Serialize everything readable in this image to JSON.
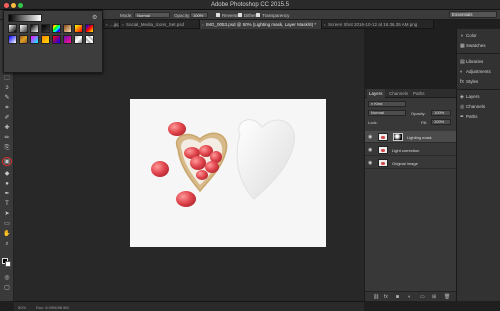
{
  "window": {
    "title": "Adobe Photoshop CC 2015.5"
  },
  "options_bar": {
    "mode_label": "Mode:",
    "mode_value": "Normal",
    "opacity_label": "Opacity:",
    "opacity_value": "100%",
    "reverse_label": "Reverse",
    "dither_label": "Dither",
    "transparency_label": "Transparency",
    "workspace": "Essentials"
  },
  "tabs": [
    {
      "label": "...jpg",
      "active": false
    },
    {
      "label": "Social_Media_Icons_Set.psd",
      "active": false
    },
    {
      "label": "IMG_0053.psd @ 50% (Lighting mask, Layer Mask/8) *",
      "active": true
    },
    {
      "label": "Screen Shot 2016-10-12 at 16.36.35 AM.png",
      "active": false
    }
  ],
  "gradient_picker": {
    "swatches": [
      "linear-gradient(135deg,#fff,#000)",
      "linear-gradient(135deg,#fff,rgba(255,255,255,0))",
      "linear-gradient(135deg,#000,#fff)",
      "linear-gradient(135deg,#000,rgba(0,0,0,0))",
      "linear-gradient(135deg,#f00,#ff0,#0f0,#0ff,#00f,#f0f)",
      "linear-gradient(135deg,#8b4513,#f5deb3)",
      "linear-gradient(135deg,#ff0,#f00)",
      "linear-gradient(135deg,#00f,#f00,#ff0)",
      "linear-gradient(135deg,#00f,#fff)",
      "linear-gradient(135deg,#a0522d,#daa520,#a0522d)",
      "linear-gradient(135deg,#f0f,#0ff)",
      "linear-gradient(135deg,#ff8c00,#ffd700)",
      "linear-gradient(135deg,#f00,#00f)",
      "linear-gradient(135deg,#6a0dad,#ff1493)",
      "linear-gradient(135deg,#c0c0c0,#fff,#808080)",
      "repeating-linear-gradient(45deg,#fff 0 2px,#bbb 2px 4px)"
    ]
  },
  "status_bar": {
    "zoom": "50%",
    "doc_info": "Doc: 8.09M/58.9M"
  },
  "layers_panel": {
    "tabs": [
      "Layers",
      "Channels",
      "Paths"
    ],
    "kind_label": "Kind",
    "blend_mode": "Normal",
    "opacity_label": "Opacity:",
    "opacity_value": "100%",
    "lock_label": "Lock:",
    "fill_label": "Fill:",
    "fill_value": "100%",
    "layers": [
      {
        "name": "Lighting mask",
        "selected": true,
        "has_mask": true
      },
      {
        "name": "Light correction",
        "selected": false,
        "has_mask": false
      },
      {
        "name": "Original image",
        "selected": false,
        "has_mask": false
      }
    ],
    "footer_icons": [
      "link-icon",
      "fx-icon",
      "mask-icon",
      "adjustment-icon",
      "folder-icon",
      "new-layer-icon",
      "trash-icon"
    ]
  },
  "right_dock": {
    "groups": [
      [
        {
          "label": "Color",
          "icon": "color-icon"
        },
        {
          "label": "Swatches",
          "icon": "swatches-icon"
        }
      ],
      [
        {
          "label": "Libraries",
          "icon": "libraries-icon"
        },
        {
          "label": "Adjustments",
          "icon": "adjustments-icon"
        },
        {
          "label": "Styles",
          "icon": "styles-icon"
        }
      ],
      [
        {
          "label": "Layers",
          "icon": "layers-icon"
        },
        {
          "label": "Channels",
          "icon": "channels-icon"
        },
        {
          "label": "Paths",
          "icon": "paths-icon"
        }
      ]
    ]
  },
  "tools": [
    "move-tool",
    "marquee-tool",
    "lasso-tool",
    "quick-select-tool",
    "crop-tool",
    "eyedropper-tool",
    "healing-tool",
    "brush-tool",
    "clone-tool",
    "history-brush-tool",
    "eraser-tool",
    "gradient-tool",
    "blur-tool",
    "dodge-tool",
    "pen-tool",
    "type-tool",
    "path-select-tool",
    "shape-tool",
    "hand-tool",
    "zoom-tool"
  ]
}
